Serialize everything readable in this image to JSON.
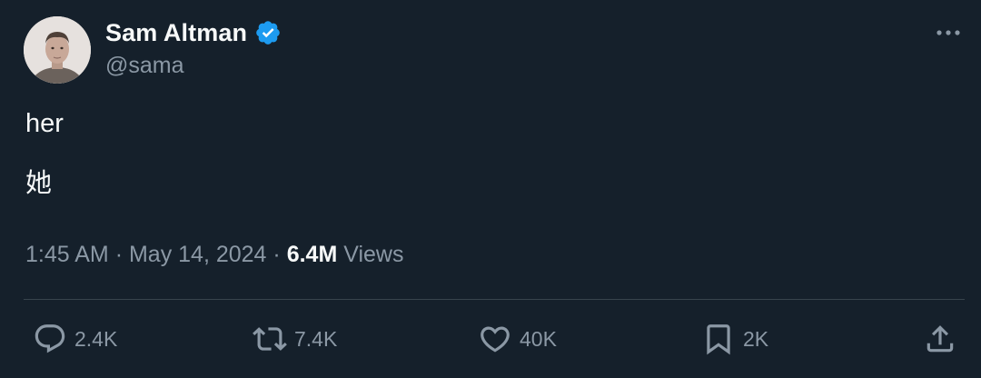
{
  "author": {
    "display_name": "Sam Altman",
    "handle": "@sama",
    "verified": true,
    "verified_color": "#1d9bf0"
  },
  "tweet": {
    "lines": [
      "her",
      "她"
    ]
  },
  "meta": {
    "time": "1:45 AM",
    "separator": "·",
    "date": "May 14, 2024",
    "views_count": "6.4M",
    "views_label": "Views"
  },
  "actions": {
    "reply": {
      "icon": "reply-icon",
      "count": "2.4K"
    },
    "retweet": {
      "icon": "retweet-icon",
      "count": "7.4K"
    },
    "like": {
      "icon": "heart-icon",
      "count": "40K"
    },
    "bookmark": {
      "icon": "bookmark-icon",
      "count": "2K"
    },
    "share": {
      "icon": "share-icon"
    }
  },
  "colors": {
    "background": "#15202b",
    "primary_text": "#f7f9f9",
    "secondary_text": "#8b98a5",
    "divider": "#38444d"
  }
}
